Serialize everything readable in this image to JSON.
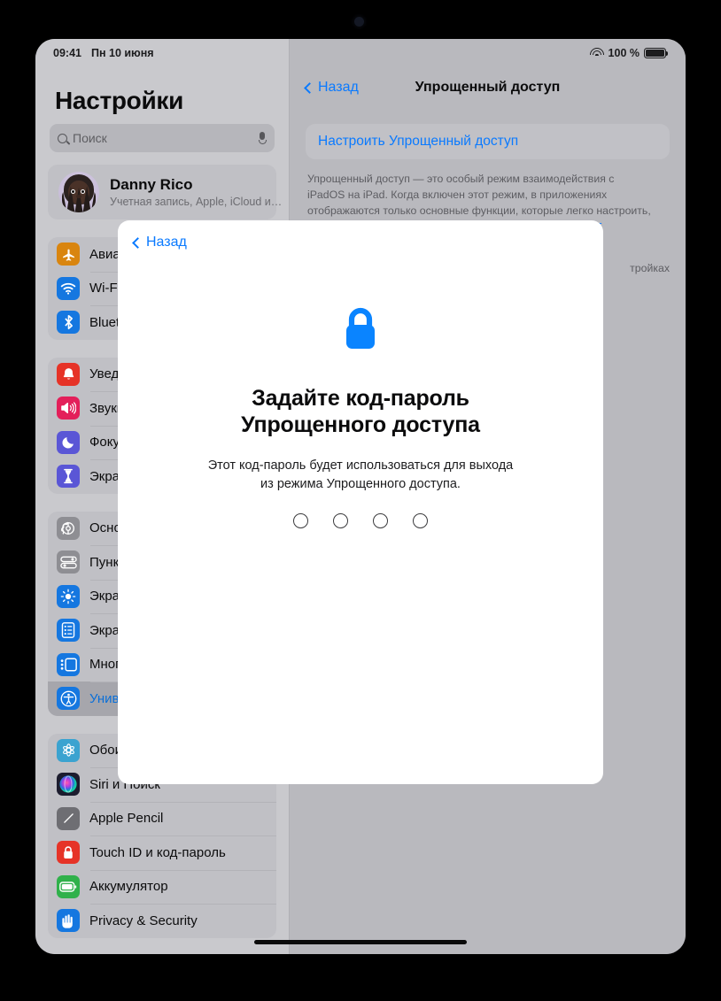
{
  "status_bar": {
    "time": "09:41",
    "date": "Пн 10 июня",
    "wifi_icon": "wifi-icon",
    "battery_percent": "100 %",
    "battery_icon": "battery-full-icon"
  },
  "sidebar": {
    "title": "Настройки",
    "search": {
      "placeholder": "Поиск",
      "search_icon": "search-icon",
      "mic_icon": "microphone-icon"
    },
    "account": {
      "name": "Danny Rico",
      "subtitle": "Учетная запись, Apple, iCloud и…",
      "avatar_icon": "avatar"
    },
    "groups": [
      {
        "items": [
          {
            "label": "Авиарежим",
            "icon": "airplane-icon",
            "color": "#d9850f",
            "selected": false
          },
          {
            "label": "Wi-Fi",
            "icon": "wifi-icon",
            "color": "#1577e0",
            "selected": false
          },
          {
            "label": "Bluetooth",
            "icon": "bluetooth-icon",
            "color": "#1577e0",
            "selected": false
          }
        ]
      },
      {
        "items": [
          {
            "label": "Уведомления",
            "icon": "bell-icon",
            "color": "#e63327",
            "selected": false
          },
          {
            "label": "Звуки",
            "icon": "speaker-icon",
            "color": "#e31f5a",
            "selected": false
          },
          {
            "label": "Фокусирование",
            "icon": "moon-icon",
            "color": "#5a56d6",
            "selected": false
          },
          {
            "label": "Экранное время",
            "icon": "hourglass-icon",
            "color": "#5a56d6",
            "selected": false
          }
        ]
      },
      {
        "items": [
          {
            "label": "Основные",
            "icon": "gear-icon",
            "color": "#8e8e93",
            "selected": false
          },
          {
            "label": "Пункт управления",
            "icon": "toggles-icon",
            "color": "#8e8e93",
            "selected": false
          },
          {
            "label": "Экран и яркость",
            "icon": "brightness-icon",
            "color": "#1577e0",
            "selected": false
          },
          {
            "label": "Экран «Домой»",
            "icon": "home-screen-icon",
            "color": "#1577e0",
            "selected": false
          },
          {
            "label": "Многозадачность",
            "icon": "multitasking-icon",
            "color": "#1577e0",
            "selected": false
          },
          {
            "label": "Универсальный доступ",
            "icon": "accessibility-icon",
            "color": "#1577e0",
            "selected": true
          }
        ]
      },
      {
        "items": [
          {
            "label": "Обои",
            "icon": "wallpaper-icon",
            "color": "#3ba3d0",
            "selected": false
          },
          {
            "label": "Siri и Поиск",
            "icon": "siri-icon",
            "color": "#1c1c2e",
            "selected": false
          },
          {
            "label": "Apple Pencil",
            "icon": "pencil-icon",
            "color": "#6e6e73",
            "selected": false
          },
          {
            "label": "Touch ID и код-пароль",
            "icon": "lock-icon",
            "color": "#e63327",
            "selected": false
          },
          {
            "label": "Аккумулятор",
            "icon": "battery-icon",
            "color": "#30b14b",
            "selected": false
          },
          {
            "label": "Privacy & Security",
            "icon": "hand-icon",
            "color": "#1577e0",
            "selected": false
          }
        ]
      }
    ]
  },
  "detail": {
    "back_label": "Назад",
    "back_icon": "chevron-left-icon",
    "title": "Упрощенный доступ",
    "setup_row_label": "Настроить Упрощенный доступ",
    "description": "Упрощенный доступ — это особый режим взаимодействия с iPadOS на iPad. Когда включен этот режим, в приложениях отображаются только основные функции, которые легко настроить, а элементы интерфейса выглядят крупнее. ",
    "description_link": "Подробнее об Упрощенном доступе…",
    "description_partial": "тройках"
  },
  "modal": {
    "back_label": "Назад",
    "back_icon": "chevron-left-icon",
    "lock_icon": "lock-icon",
    "lock_color": "#0a84ff",
    "title_line1": "Задайте код-пароль",
    "title_line2": "Упрощенного доступа",
    "subtitle_line1": "Этот код-пароль будет использоваться для выхода",
    "subtitle_line2": "из режима Упрощенного доступа.",
    "passcode_dots": 4,
    "passcode_entered": 0
  },
  "home_indicator": "home-indicator"
}
